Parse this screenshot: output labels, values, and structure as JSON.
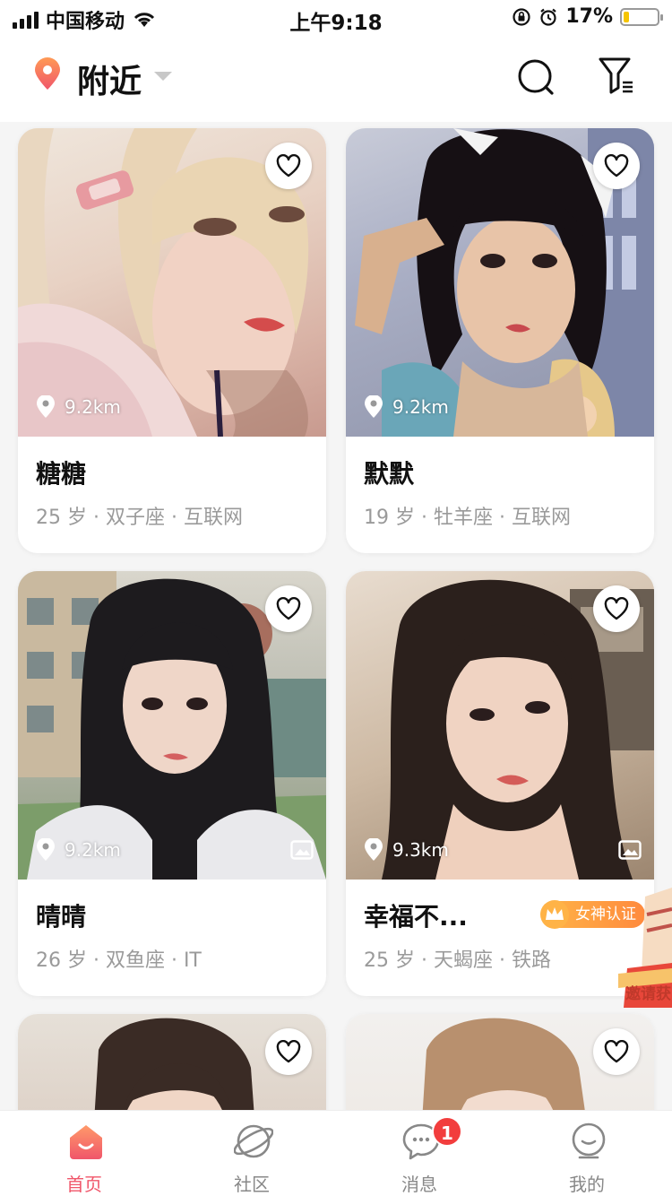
{
  "status_bar": {
    "carrier": "中国移动",
    "time": "上午9:18",
    "battery": "17%",
    "battery_level": 0.17
  },
  "header": {
    "title": "附近",
    "location_icon": "location-pin-icon",
    "search_icon": "search-icon",
    "filter_icon": "filter-icon"
  },
  "cards": [
    {
      "name": "糖糖",
      "meta": "25 岁 · 双子座 · 互联网",
      "distance": "9.2km"
    },
    {
      "name": "默默",
      "meta": "19 岁 · 牡羊座 · 互联网",
      "distance": "9.2km"
    },
    {
      "name": "晴晴",
      "meta": "26 岁 · 双鱼座 · IT",
      "distance": "9.2km"
    },
    {
      "name": "幸福不...",
      "meta": "25 岁 · 天蝎座 · 铁路",
      "distance": "9.3km",
      "badge": "女神认证"
    }
  ],
  "promo": {
    "text": "邀请获"
  },
  "tabbar": {
    "tabs": [
      {
        "label": "首页",
        "icon": "home-icon"
      },
      {
        "label": "社区",
        "icon": "planet-icon"
      },
      {
        "label": "消息",
        "icon": "chat-bubble-icon",
        "badge": "1"
      },
      {
        "label": "我的",
        "icon": "profile-icon"
      }
    ]
  },
  "colors": {
    "accent": "#f0566a",
    "badge_red": "#f23d3d",
    "badge_gold": "#ff8a3d"
  }
}
